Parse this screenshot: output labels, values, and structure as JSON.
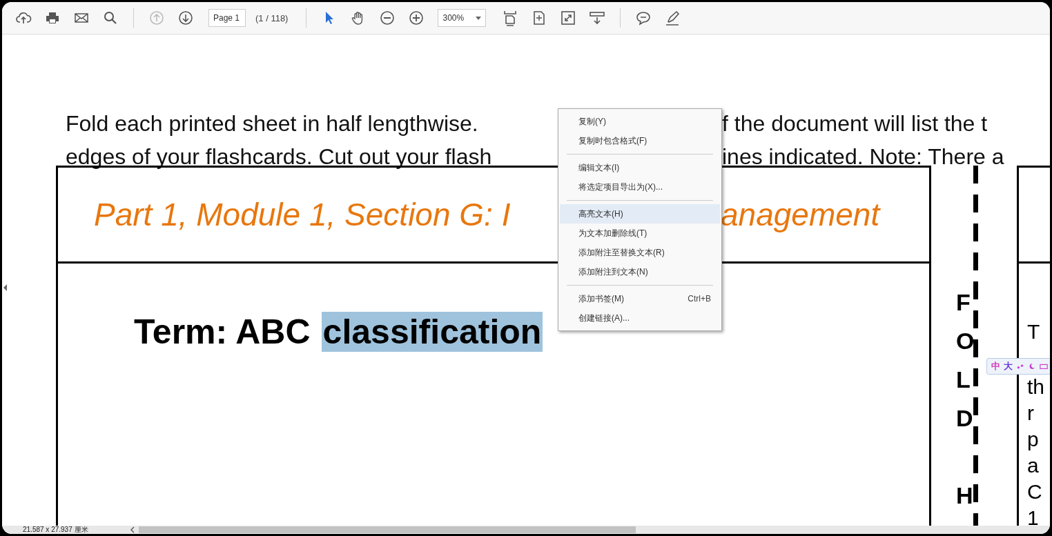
{
  "toolbar": {
    "prev_page_disabled": true,
    "next_page_disabled": false,
    "page_field": "Page 1",
    "page_count": "(1 / 118)",
    "zoom": "300%",
    "select_tool_active": true,
    "hand_tool_active": false
  },
  "document": {
    "intro_lines": [
      {
        "left": "Fold each printed sheet in half lengthwise.",
        "right": "f the document will list the t"
      },
      {
        "left": "edges of your flashcards. Cut out your flash",
        "right": "ines indicated. Note: There a"
      }
    ],
    "card_title_left": "Part 1, Module 1, Section G: I",
    "card_title_right": "anagement",
    "term_label": "Term: ABC",
    "term_selected": "classification",
    "fold_words": [
      "FOLD",
      "H"
    ],
    "back_fragments": [
      "T",
      "th",
      "r",
      "p",
      "a",
      "C",
      "1"
    ]
  },
  "context_menu": {
    "groups": [
      [
        {
          "label": "复制(Y)",
          "selected": false
        },
        {
          "label": "复制时包含格式(F)",
          "selected": false
        }
      ],
      [
        {
          "label": "编辑文本(I)",
          "selected": false
        },
        {
          "label": "将选定项目导出为(X)...",
          "selected": false
        }
      ],
      [
        {
          "label": "高亮文本(H)",
          "selected": true
        },
        {
          "label": "为文本加删除线(T)",
          "selected": false
        },
        {
          "label": "添加附注至替换文本(R)",
          "selected": false
        },
        {
          "label": "添加附注到文本(N)",
          "selected": false
        }
      ],
      [
        {
          "label": "添加书签(M)",
          "shortcut": "Ctrl+B",
          "selected": false
        },
        {
          "label": "创建链接(A)...",
          "selected": false
        }
      ]
    ]
  },
  "ime_bar": {
    "mode": "中",
    "width": "大"
  },
  "status_bar": {
    "page_size": "21.587 x 27.937 厘米"
  }
}
